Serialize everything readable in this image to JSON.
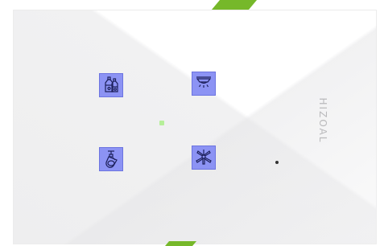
{
  "panel": {
    "brand_text": "HIZOAL",
    "accent_color": "#76b82a",
    "key_color": "#8c93f4",
    "key_border_color": "#6c74e0",
    "indicator_color": "#b6ef9a",
    "keys": [
      {
        "icon": "bottles-icon"
      },
      {
        "icon": "ceiling-light-icon"
      },
      {
        "icon": "spotlight-icon"
      },
      {
        "icon": "ceiling-fan-icon"
      }
    ]
  }
}
